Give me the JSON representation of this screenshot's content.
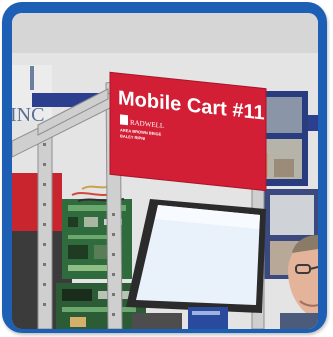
{
  "sign": {
    "title": "Mobile Cart #11",
    "logo_text": "RADWELL",
    "line1": "AREA BROWN BEIGE",
    "line2": "BALEY RIPNI"
  },
  "wall_sign": {
    "text": "INC"
  },
  "colors": {
    "frame_blue": "#1d5fb4",
    "sign_red": "#d21f35",
    "wall": "#e6e6e6",
    "monitor_screen": "#e9f2fb"
  }
}
